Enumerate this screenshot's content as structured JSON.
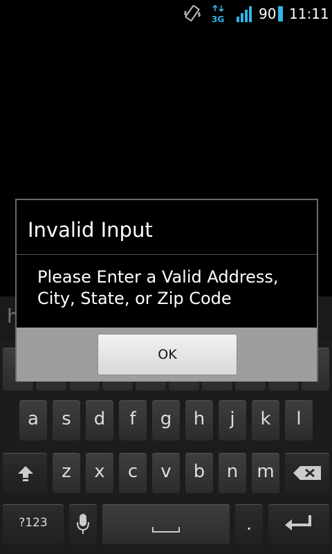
{
  "status_bar": {
    "battery_percent": "90",
    "time": "11:11",
    "network": "3G",
    "colors": {
      "accent": "#33b5e5"
    }
  },
  "search": {
    "value": "hdueud"
  },
  "dialog": {
    "title": "Invalid Input",
    "message": "Please Enter a Valid Address, City, State, or Zip Code",
    "ok_label": "OK"
  },
  "keyboard": {
    "row2": [
      "a",
      "s",
      "d",
      "f",
      "g",
      "h",
      "j",
      "k",
      "l"
    ],
    "row3": [
      "z",
      "x",
      "c",
      "v",
      "b",
      "n",
      "m"
    ],
    "symbols_label": "?123",
    "period_label": ".",
    "icons": [
      "shift-icon",
      "backspace-icon",
      "microphone-icon",
      "space-icon",
      "enter-icon"
    ]
  }
}
